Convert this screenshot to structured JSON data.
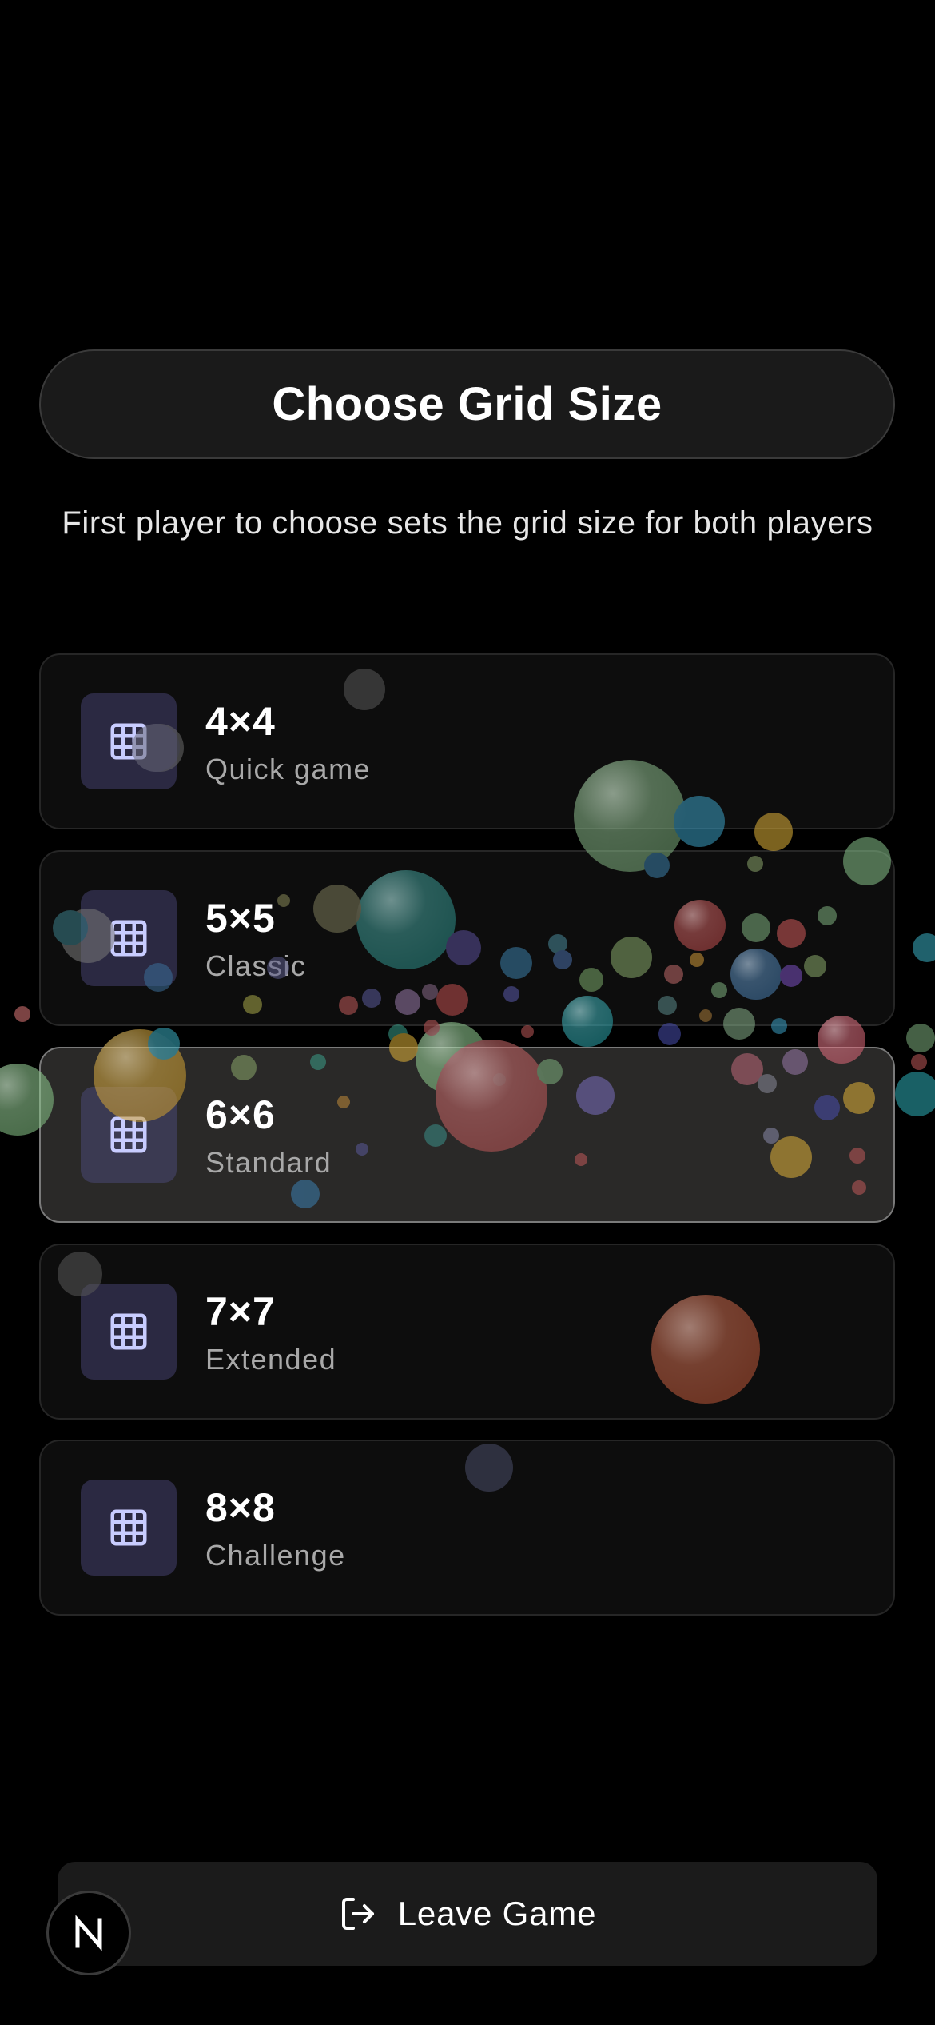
{
  "header": {
    "title": "Choose Grid Size",
    "subtitle": "First player to choose sets the grid size for both players"
  },
  "grid_options": [
    {
      "size": "4×4",
      "description": "Quick game",
      "selected": false,
      "icon": "grid-icon"
    },
    {
      "size": "5×5",
      "description": "Classic",
      "selected": false,
      "icon": "grid-icon"
    },
    {
      "size": "6×6",
      "description": "Standard",
      "selected": true,
      "icon": "grid-icon"
    },
    {
      "size": "7×7",
      "description": "Extended",
      "selected": false,
      "icon": "grid-icon"
    },
    {
      "size": "8×8",
      "description": "Challenge",
      "selected": false,
      "icon": "grid-icon"
    }
  ],
  "footer": {
    "leave_label": "Leave Game",
    "leave_icon": "log-out-icon",
    "badge_letter": "N"
  },
  "colors": {
    "background": "#000000",
    "card": "#0d0d0d",
    "card_selected": "#2a2928",
    "icon_box": "#2b2942",
    "icon_stroke": "#c8ccff"
  }
}
